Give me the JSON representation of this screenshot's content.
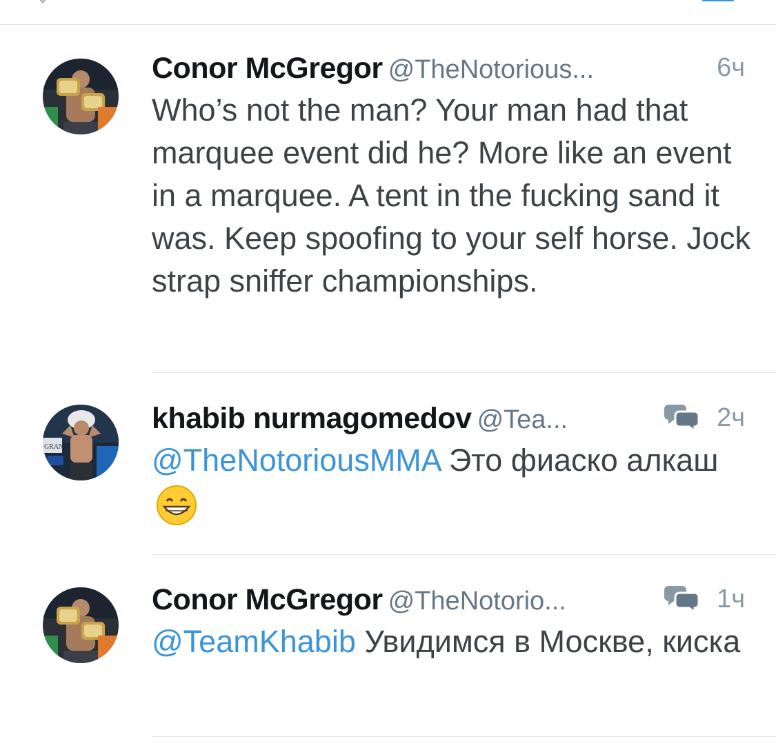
{
  "tweets": [
    {
      "name": "Conor McGregor",
      "handle": "@TheNotorious...",
      "time": "6ч",
      "text": "Who’s not the man? Your man had that marquee event did he? More like an event in a marquee. A tent in the fucking sand it was. Keep spoofing to your self horse. Jock strap sniffer championships."
    },
    {
      "name": "khabib nurmagomedov",
      "handle": "@Tea...",
      "time": "2ч",
      "mention": "@TheNotoriousMMA",
      "text": " Это фиаско алкаш",
      "emoji": "grinning-face-emoji",
      "avatar_label": "GRAN"
    },
    {
      "name": "Conor McGregor",
      "handle": "@TheNotorio...",
      "time": "1ч",
      "mention": "@TeamKhabib",
      "text": " Увидимся в Москве, киска"
    }
  ],
  "colors": {
    "link": "#3b94d9",
    "name": "#14171a",
    "body_text": "#3d4247",
    "meta": "#8899a6"
  }
}
